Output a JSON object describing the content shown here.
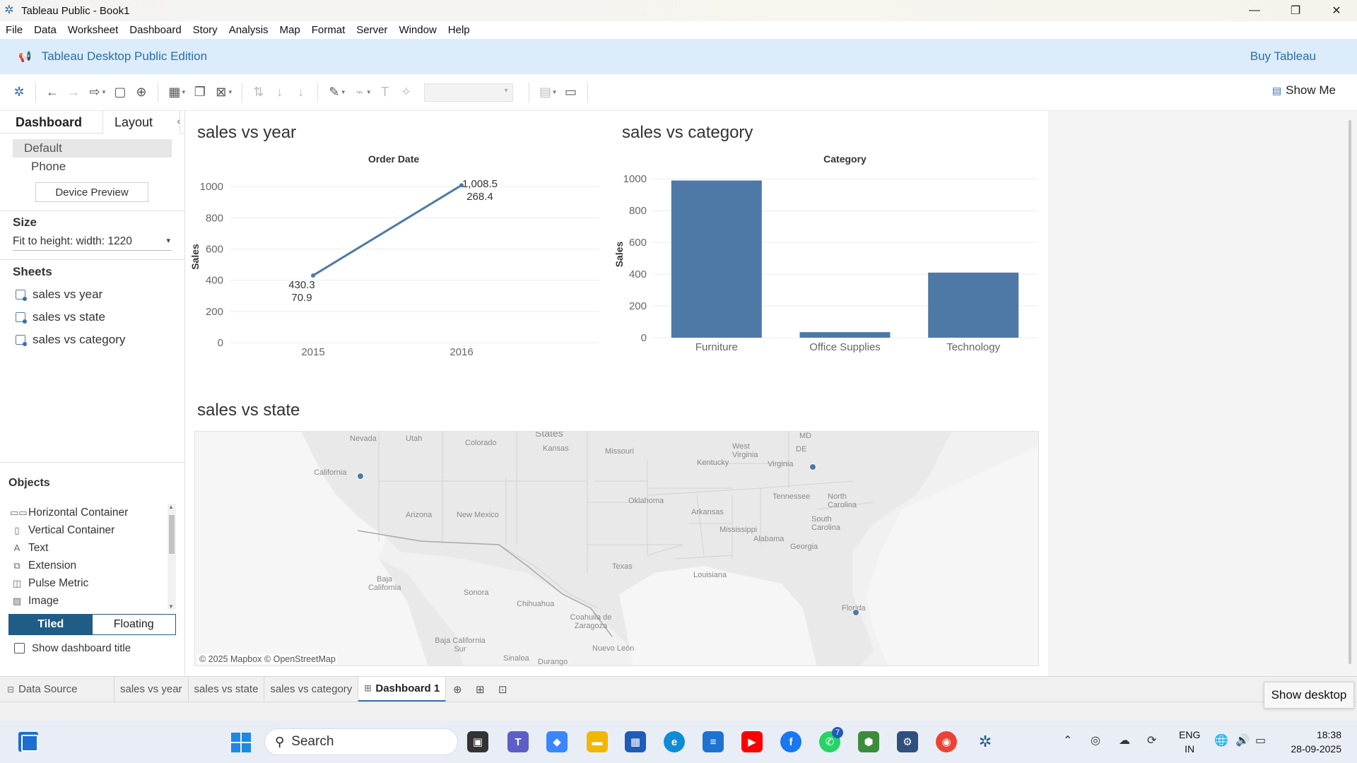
{
  "window": {
    "title": "Tableau Public - Book1",
    "minimize": "—",
    "maximize": "❐",
    "close": "✕"
  },
  "menu": [
    "File",
    "Data",
    "Worksheet",
    "Dashboard",
    "Story",
    "Analysis",
    "Map",
    "Format",
    "Server",
    "Window",
    "Help"
  ],
  "banner": {
    "edition": "Tableau Desktop Public Edition",
    "buy": "Buy Tableau"
  },
  "toolbar": {
    "show_me": "Show Me"
  },
  "leftpane": {
    "tab_dashboard": "Dashboard",
    "tab_layout": "Layout",
    "device_default": "Default",
    "device_phone": "Phone",
    "device_preview": "Device Preview",
    "size_heading": "Size",
    "size_value": "Fit to height: width: 1220",
    "sheets_heading": "Sheets",
    "sheets": [
      "sales vs year",
      "sales vs state",
      "sales vs category"
    ],
    "objects_heading": "Objects",
    "objects": [
      {
        "label": "Horizontal Container",
        "icon": "horizontal-container-icon"
      },
      {
        "label": "Vertical Container",
        "icon": "vertical-container-icon"
      },
      {
        "label": "Text",
        "icon": "text-icon"
      },
      {
        "label": "Extension",
        "icon": "extension-icon"
      },
      {
        "label": "Pulse Metric",
        "icon": "pulse-metric-icon"
      },
      {
        "label": "Image",
        "icon": "image-icon"
      }
    ],
    "tiled": "Tiled",
    "floating": "Floating",
    "show_title": "Show dashboard title"
  },
  "dashboard": {
    "sheet1_title": "sales vs year",
    "sheet2_title": "sales vs category",
    "sheet3_title": "sales vs state",
    "map": {
      "credit": "© 2025 Mapbox © OpenStreetMap",
      "labels": [
        {
          "text": "Nevada"
        },
        {
          "text": "Utah"
        },
        {
          "text": "Colorado"
        },
        {
          "text": "States"
        },
        {
          "text": "Kansas"
        },
        {
          "text": "Missouri"
        },
        {
          "text": "Kentucky"
        },
        {
          "text": "West Virginia"
        },
        {
          "text": "Virginia"
        },
        {
          "text": "MD"
        },
        {
          "text": "DE"
        },
        {
          "text": "California"
        },
        {
          "text": "Oklahoma"
        },
        {
          "text": "Tennessee"
        },
        {
          "text": "North Carolina"
        },
        {
          "text": "Arizona"
        },
        {
          "text": "New Mexico"
        },
        {
          "text": "Arkansas"
        },
        {
          "text": "South Carolina"
        },
        {
          "text": "Mississippi"
        },
        {
          "text": "Alabama"
        },
        {
          "text": "Georgia"
        },
        {
          "text": "Texas"
        },
        {
          "text": "Louisiana"
        },
        {
          "text": "Baja California"
        },
        {
          "text": "Sonora"
        },
        {
          "text": "Chihuahua"
        },
        {
          "text": "Coahuila de Zaragoza"
        },
        {
          "text": "Baja California Sur"
        },
        {
          "text": "Nuevo León"
        },
        {
          "text": "Sinaloa"
        },
        {
          "text": "Durango"
        },
        {
          "text": "Florida"
        }
      ],
      "points": [
        "California",
        "Kentucky",
        "Florida"
      ]
    }
  },
  "chart_data": [
    {
      "type": "line",
      "title": "sales vs year",
      "xlabel": "Order Date",
      "ylabel": "Sales",
      "x": [
        "2015",
        "2016"
      ],
      "series": [
        {
          "values": [
            430.3,
            1008.5
          ],
          "second_labels": [
            "70.9",
            "268.4"
          ],
          "value_labels": [
            "430.3",
            "1,008.5"
          ]
        }
      ],
      "ylim": [
        0,
        1100
      ],
      "yticks": [
        0,
        200,
        400,
        600,
        800,
        1000
      ],
      "grid": true
    },
    {
      "type": "bar",
      "title": "sales vs category",
      "xlabel": "Category",
      "ylabel": "Sales",
      "categories": [
        "Furniture",
        "Office Supplies",
        "Technology"
      ],
      "values": [
        990,
        35,
        410
      ],
      "ylim": [
        0,
        1050
      ],
      "yticks": [
        0,
        200,
        400,
        600,
        800,
        1000
      ],
      "color": "#4e79a7",
      "grid": true
    }
  ],
  "tabs": {
    "data_source": "Data Source",
    "sheets": [
      "sales vs year",
      "sales vs state",
      "sales vs category"
    ],
    "active": "Dashboard 1"
  },
  "tooltip": "Show desktop",
  "taskbar": {
    "search": "Search",
    "whatsapp_badge": "7",
    "lang_top": "ENG",
    "lang_bottom": "IN",
    "time": "18:38",
    "date": "28-09-2025"
  }
}
